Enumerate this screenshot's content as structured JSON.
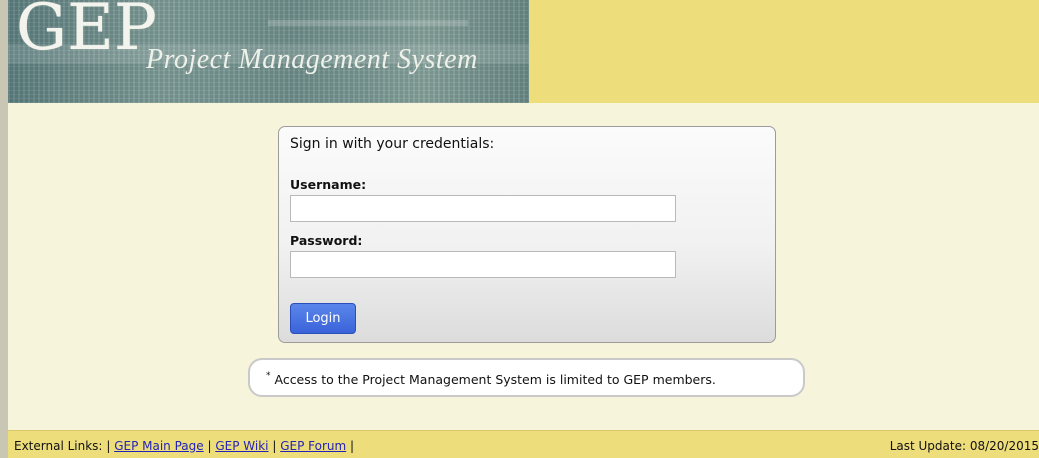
{
  "header": {
    "logo_text": "GEP",
    "logo_subtitle": "Project Management System"
  },
  "login": {
    "title": "Sign in with your credentials:",
    "username_label": "Username:",
    "username_value": "",
    "password_label": "Password:",
    "password_value": "",
    "button_label": "Login"
  },
  "notice": {
    "marker": "*",
    "text": "Access to the Project Management System is limited to GEP members."
  },
  "footer": {
    "links_label": "External Links:",
    "separator": "|",
    "links": [
      "GEP Main Page",
      "GEP Wiki",
      "GEP Forum"
    ],
    "last_update": "Last Update: 08/20/2015"
  },
  "colors": {
    "background": "#f7f4dc",
    "header_bar": "#eede7b",
    "button": "#3a63d9",
    "link": "#2323b8"
  }
}
